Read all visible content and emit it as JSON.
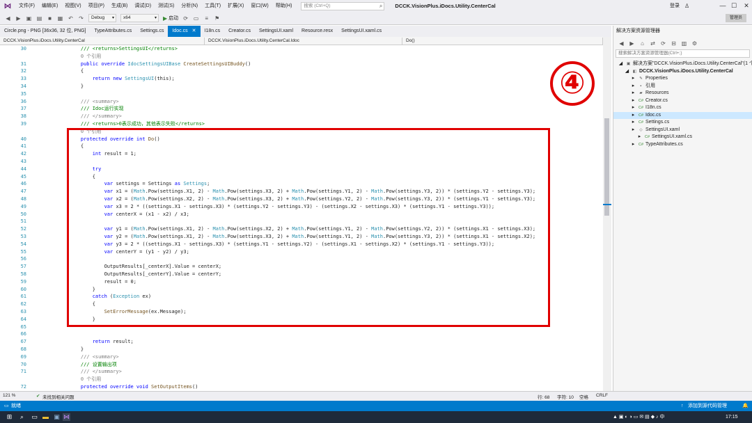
{
  "app": {
    "menus": [
      "文件(F)",
      "编辑(E)",
      "视图(V)",
      "项目(P)",
      "生成(B)",
      "调试(D)",
      "测试(S)",
      "分析(N)",
      "工具(T)",
      "扩展(X)",
      "窗口(W)",
      "帮助(H)"
    ],
    "search_placeholder": "搜索 (Ctrl+Q)",
    "solution_name": "DCCK.VisionPlus.iDocs.Utility.CenterCal",
    "login": "登录",
    "minimize": "—",
    "maximize": "☐",
    "close": "✕"
  },
  "toolbar": {
    "config": "Debug",
    "platform": "x64",
    "start_label": "启动",
    "admin_label": "管理员"
  },
  "tabs": [
    {
      "label": "Circle.png - PNG [36x36, 32 位, PNG]"
    },
    {
      "label": "TypeAttributes.cs"
    },
    {
      "label": "Settings.cs"
    },
    {
      "label": "Idoc.cs"
    },
    {
      "label": "I18n.cs"
    },
    {
      "label": "Creator.cs"
    },
    {
      "label": "SettingsUI.xaml"
    },
    {
      "label": "Resource.resx"
    },
    {
      "label": "SettingsUI.xaml.cs"
    }
  ],
  "nav": {
    "project": "DCCK.VisionPlus.iDocs.Utility.CenterCal",
    "class": "DCCK.VisionPlus.iDocs.Utility.CenterCal.Idoc",
    "member": "Do()"
  },
  "code_lines": [
    {
      "n": "30",
      "segs": [
        [
          "cm",
          "    /// <returns>SettingsUI</returns>"
        ]
      ]
    },
    {
      "n": "",
      "segs": [
        [
          "gr",
          "    0 个引用"
        ]
      ]
    },
    {
      "n": "31",
      "segs": [
        [
          "kw",
          "    public override "
        ],
        [
          "ty",
          "IdocSettingsUIBase "
        ],
        [
          "fn",
          "CreateSettingsUIBuddy"
        ],
        [
          "",
          "()"
        ]
      ]
    },
    {
      "n": "32",
      "segs": [
        [
          "",
          "    {"
        ]
      ]
    },
    {
      "n": "33",
      "segs": [
        [
          "kw",
          "        return new "
        ],
        [
          "ty",
          "SettingsUI"
        ],
        [
          "",
          "(this);"
        ]
      ]
    },
    {
      "n": "34",
      "segs": [
        [
          "",
          "    }"
        ]
      ]
    },
    {
      "n": "35",
      "segs": [
        [
          "",
          "    "
        ]
      ]
    },
    {
      "n": "36",
      "segs": [
        [
          "gr",
          "    /// <summary>"
        ]
      ]
    },
    {
      "n": "37",
      "segs": [
        [
          "cm",
          "    /// Idoc运行实现"
        ]
      ]
    },
    {
      "n": "38",
      "segs": [
        [
          "gr",
          "    /// </summary>"
        ]
      ]
    },
    {
      "n": "39",
      "segs": [
        [
          "cm",
          "    /// <returns>0表示成功，其他表示失败</returns>"
        ]
      ]
    },
    {
      "n": "",
      "segs": [
        [
          "gr",
          "    0 个引用"
        ]
      ]
    },
    {
      "n": "40",
      "segs": [
        [
          "kw",
          "    protected override int "
        ],
        [
          "fn",
          "Do"
        ],
        [
          "",
          "()"
        ]
      ]
    },
    {
      "n": "41",
      "segs": [
        [
          "",
          "    {"
        ]
      ]
    },
    {
      "n": "42",
      "segs": [
        [
          "kw",
          "        int "
        ],
        [
          "",
          "result = 1;"
        ]
      ]
    },
    {
      "n": "43",
      "segs": [
        [
          "",
          "    "
        ]
      ]
    },
    {
      "n": "44",
      "segs": [
        [
          "kw",
          "        try"
        ]
      ]
    },
    {
      "n": "45",
      "segs": [
        [
          "",
          "        {"
        ]
      ]
    },
    {
      "n": "46",
      "segs": [
        [
          "kw",
          "            var "
        ],
        [
          "",
          "settings = Settings "
        ],
        [
          "kw",
          "as "
        ],
        [
          "ty",
          "Settings"
        ],
        [
          "",
          ";"
        ]
      ]
    },
    {
      "n": "47",
      "segs": [
        [
          "kw",
          "            var "
        ],
        [
          "",
          "x1 = ("
        ],
        [
          "ty",
          "Math"
        ],
        [
          "",
          ".Pow(settings.X1, 2) - "
        ],
        [
          "ty",
          "Math"
        ],
        [
          "",
          ".Pow(settings.X3, 2) + "
        ],
        [
          "ty",
          "Math"
        ],
        [
          "",
          ".Pow(settings.Y1, 2) - "
        ],
        [
          "ty",
          "Math"
        ],
        [
          "",
          ".Pow(settings.Y3, 2)) * (settings.Y2 - settings.Y3);"
        ]
      ]
    },
    {
      "n": "48",
      "segs": [
        [
          "kw",
          "            var "
        ],
        [
          "",
          "x2 = ("
        ],
        [
          "ty",
          "Math"
        ],
        [
          "",
          ".Pow(settings.X2, 2) - "
        ],
        [
          "ty",
          "Math"
        ],
        [
          "",
          ".Pow(settings.X3, 2) + "
        ],
        [
          "ty",
          "Math"
        ],
        [
          "",
          ".Pow(settings.Y2, 2) - "
        ],
        [
          "ty",
          "Math"
        ],
        [
          "",
          ".Pow(settings.Y3, 2)) * (settings.Y1 - settings.Y3);"
        ]
      ]
    },
    {
      "n": "49",
      "segs": [
        [
          "kw",
          "            var "
        ],
        [
          "",
          "x3 = 2 * ((settings.X1 - settings.X3) * (settings.Y2 - settings.Y3) - (settings.X2 - settings.X3) * (settings.Y1 - settings.Y3));"
        ]
      ]
    },
    {
      "n": "50",
      "segs": [
        [
          "kw",
          "            var "
        ],
        [
          "",
          "centerX = (x1 - x2) / x3;"
        ]
      ]
    },
    {
      "n": "51",
      "segs": [
        [
          "",
          "    "
        ]
      ]
    },
    {
      "n": "52",
      "segs": [
        [
          "kw",
          "            var "
        ],
        [
          "",
          "y1 = ("
        ],
        [
          "ty",
          "Math"
        ],
        [
          "",
          ".Pow(settings.X1, 2) - "
        ],
        [
          "ty",
          "Math"
        ],
        [
          "",
          ".Pow(settings.X2, 2) + "
        ],
        [
          "ty",
          "Math"
        ],
        [
          "",
          ".Pow(settings.Y1, 2) - "
        ],
        [
          "ty",
          "Math"
        ],
        [
          "",
          ".Pow(settings.Y2, 2)) * (settings.X1 - settings.X3);"
        ]
      ]
    },
    {
      "n": "53",
      "segs": [
        [
          "kw",
          "            var "
        ],
        [
          "",
          "y2 = ("
        ],
        [
          "ty",
          "Math"
        ],
        [
          "",
          ".Pow(settings.X1, 2) - "
        ],
        [
          "ty",
          "Math"
        ],
        [
          "",
          ".Pow(settings.X3, 2) + "
        ],
        [
          "ty",
          "Math"
        ],
        [
          "",
          ".Pow(settings.Y1, 2) - "
        ],
        [
          "ty",
          "Math"
        ],
        [
          "",
          ".Pow(settings.Y3, 2)) * (settings.X1 - settings.X2);"
        ]
      ]
    },
    {
      "n": "54",
      "segs": [
        [
          "kw",
          "            var "
        ],
        [
          "",
          "y3 = 2 * ((settings.X1 - settings.X3) * (settings.Y1 - settings.Y2) - (settings.X1 - settings.X2) * (settings.Y1 - settings.Y3));"
        ]
      ]
    },
    {
      "n": "55",
      "segs": [
        [
          "kw",
          "            var "
        ],
        [
          "",
          "centerY = (y1 - y2) / y3;"
        ]
      ]
    },
    {
      "n": "56",
      "segs": [
        [
          "",
          "    "
        ]
      ]
    },
    {
      "n": "57",
      "segs": [
        [
          "",
          "            OutputResults[_centerX].Value = centerX;"
        ]
      ]
    },
    {
      "n": "58",
      "segs": [
        [
          "",
          "            OutputResults[_centerY].Value = centerY;"
        ]
      ]
    },
    {
      "n": "59",
      "segs": [
        [
          "",
          "            result = 0;"
        ]
      ]
    },
    {
      "n": "60",
      "segs": [
        [
          "",
          "        }"
        ]
      ]
    },
    {
      "n": "61",
      "segs": [
        [
          "kw",
          "        catch "
        ],
        [
          "",
          "("
        ],
        [
          "ty",
          "Exception "
        ],
        [
          "",
          "ex)"
        ]
      ]
    },
    {
      "n": "62",
      "segs": [
        [
          "",
          "        {"
        ]
      ]
    },
    {
      "n": "63",
      "segs": [
        [
          "fn",
          "            SetErrorMessage"
        ],
        [
          "",
          "(ex.Message);"
        ]
      ]
    },
    {
      "n": "64",
      "segs": [
        [
          "",
          "        }"
        ]
      ]
    },
    {
      "n": "65",
      "segs": [
        [
          "",
          "    "
        ]
      ]
    },
    {
      "n": "66",
      "segs": [
        [
          "",
          "    "
        ]
      ]
    },
    {
      "n": "67",
      "segs": [
        [
          "kw",
          "        return "
        ],
        [
          "",
          "result;"
        ]
      ]
    },
    {
      "n": "68",
      "segs": [
        [
          "",
          "    }"
        ]
      ]
    },
    {
      "n": "69",
      "segs": [
        [
          "gr",
          "    /// <summary>"
        ]
      ]
    },
    {
      "n": "70",
      "segs": [
        [
          "cm",
          "    /// 设置输出项"
        ]
      ]
    },
    {
      "n": "71",
      "segs": [
        [
          "gr",
          "    /// </summary>"
        ]
      ]
    },
    {
      "n": "",
      "segs": [
        [
          "gr",
          "    0 个引用"
        ]
      ]
    },
    {
      "n": "72",
      "segs": [
        [
          "kw",
          "    protected override void "
        ],
        [
          "fn",
          "SetOutputItems"
        ],
        [
          "",
          "()"
        ]
      ]
    }
  ],
  "annotation": {
    "step": "④"
  },
  "solution_explorer": {
    "title": "解决方案资源管理器",
    "search_placeholder": "搜索解决方案资源管理器(Ctrl+;)",
    "items": [
      {
        "label": "解决方案\"DCCK.VisionPlus.iDocs.Utility.CenterCal\"(1 个项",
        "icon": "solution-icon",
        "indent": 0,
        "bold": false
      },
      {
        "label": "DCCK.VisionPlus.iDocs.Utility.CenterCal",
        "icon": "project-icon",
        "indent": 1,
        "bold": true
      },
      {
        "label": "Properties",
        "icon": "wrench-icon",
        "indent": 2,
        "bold": false
      },
      {
        "label": "引用",
        "icon": "reference-icon",
        "indent": 2,
        "bold": false
      },
      {
        "label": "Resources",
        "icon": "folder-icon",
        "indent": 2,
        "bold": false
      },
      {
        "label": "Creator.cs",
        "icon": "cs-file-icon",
        "indent": 2,
        "bold": false
      },
      {
        "label": "I18n.cs",
        "icon": "cs-file-icon",
        "indent": 2,
        "bold": false
      },
      {
        "label": "Idoc.cs",
        "icon": "cs-file-icon",
        "indent": 2,
        "bold": false,
        "selected": true
      },
      {
        "label": "Settings.cs",
        "icon": "cs-file-icon",
        "indent": 2,
        "bold": false
      },
      {
        "label": "SettingsUI.xaml",
        "icon": "xaml-file-icon",
        "indent": 2,
        "bold": false
      },
      {
        "label": "SettingsUI.xaml.cs",
        "icon": "cs-file-icon",
        "indent": 3,
        "bold": false
      },
      {
        "label": "TypeAttributes.cs",
        "icon": "cs-file-icon",
        "indent": 2,
        "bold": false
      }
    ]
  },
  "editor_status": {
    "zoom": "121 %",
    "issues": "未找到相关问题",
    "line": "行: 68",
    "char": "字符: 10",
    "whitespace": "空格",
    "eol": "CRLF"
  },
  "statusbar": {
    "ready": "就绪",
    "source_control": "添加到源代码管理"
  },
  "taskbar": {
    "time": "17:15"
  },
  "colors": {
    "accent": "#007acc",
    "annotation": "#e00000",
    "keyword": "#0000ff",
    "type": "#2b91af",
    "comment": "#008000"
  }
}
